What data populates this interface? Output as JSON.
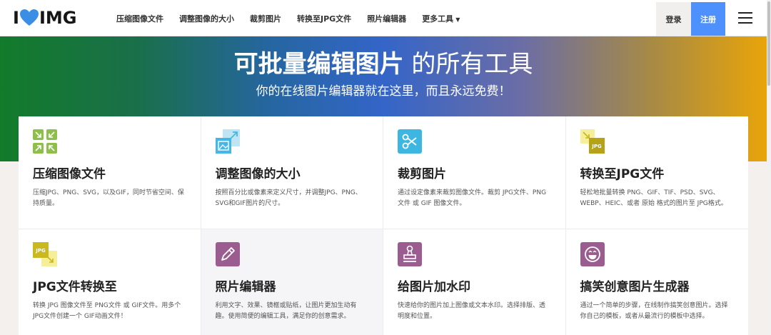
{
  "logo": {
    "left": "I",
    "right": "IMG"
  },
  "menu": [
    {
      "label": "压缩图像文件"
    },
    {
      "label": "调整图像的大小"
    },
    {
      "label": "裁剪图片"
    },
    {
      "label": "转换至JPG文件"
    },
    {
      "label": "照片编辑器"
    },
    {
      "label": "更多工具"
    }
  ],
  "auth": {
    "login": "登录",
    "signup": "注册"
  },
  "hero": {
    "title_bold": "可批量编辑图片",
    "title_light": " 的所有工具",
    "subtitle": "你的在线图片编辑器就在这里，而且永远免费！"
  },
  "colors": {
    "signup_bg": "#4d90fe",
    "compress_icon": "#8fbf4b",
    "resize_icon": "#45b6e6",
    "crop_icon": "#3db6e2",
    "jpg_icon": "#c9b81e",
    "editor_icon": "#9b5c8f"
  },
  "cards": [
    {
      "icon": "compress-icon",
      "title": "压缩图像文件",
      "desc": "压缩JPG、PNG、SVG，以及GIF，同时节省空间、保持质量。"
    },
    {
      "icon": "resize-icon",
      "title": "调整图像的大小",
      "desc": "按照百分比或像素来定义尺寸，并调整JPG、PNG、SVG和GIF图片的尺寸。"
    },
    {
      "icon": "crop-icon",
      "title": "裁剪图片",
      "desc": "通过设定像素来裁剪图像文件。裁剪 JPG文件、PNG文件 或 GIF 图像文件。"
    },
    {
      "icon": "convert-to-jpg-icon",
      "title": "转换至JPG文件",
      "desc": "轻松地批量转换 PNG、GIF、TIF、PSD、SVG、WEBP、HEIC、或者 原始 格式的图片至 JPG格式。"
    },
    {
      "icon": "convert-from-jpg-icon",
      "title": "JPG文件转换至",
      "desc": "转换 JPG 图像文件至 PNG文件 或 GIF文件。用多个JPG文件创建一个 GIF动画文件！"
    },
    {
      "icon": "photo-editor-icon",
      "title": "照片编辑器",
      "desc": "利用文字、效果、镜框或贴纸，让图片更加生动有趣。使用简便的编辑工具，满足你的创意需求。"
    },
    {
      "icon": "watermark-icon",
      "title": "给图片加水印",
      "desc": "快速给你的图片加上图像或文本水印。选择排版、透明度和位置。"
    },
    {
      "icon": "meme-generator-icon",
      "title": "搞笑创意图片生成器",
      "desc": "通过一个简单的步骤，在线制作搞笑创意图片。选择你自己的模板，或者从最流行的模板中选择。"
    }
  ]
}
